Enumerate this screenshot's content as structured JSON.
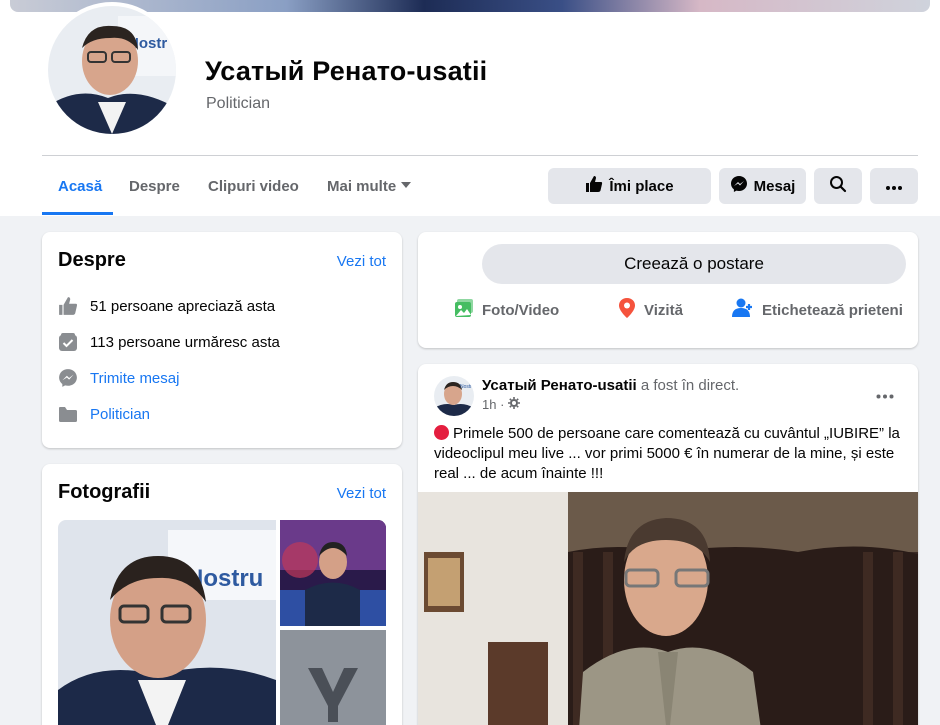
{
  "profile": {
    "name": "Усатый Ренато-usatii",
    "category": "Politician"
  },
  "tabs": [
    {
      "label": "Acasă"
    },
    {
      "label": "Despre"
    },
    {
      "label": "Clipuri video"
    },
    {
      "label": "Mai multe"
    }
  ],
  "actions": {
    "like": "Îmi place",
    "message": "Mesaj"
  },
  "about": {
    "title": "Despre",
    "see_all": "Vezi tot",
    "likes": "51 persoane apreciază asta",
    "followers": "113 persoane urmăresc asta",
    "send_message": "Trimite mesaj",
    "category": "Politician"
  },
  "photos": {
    "title": "Fotografii",
    "see_all": "Vezi tot"
  },
  "composer": {
    "create": "Creează o postare",
    "photo": "Foto/Video",
    "checkin": "Vizită",
    "tag": "Etichetează prieteni"
  },
  "post": {
    "author": "Усатый Ренато-usatii",
    "status": "a fost în direct.",
    "time": "1h ·",
    "text": "Primele 500 de persoane care comentează cu cuvântul „IUBIRE” la videoclipul meu live ... vor primi 5000 € în numerar de la mine, și este real ... de acum înainte !!!"
  },
  "colors": {
    "accent": "#1877f2",
    "background": "#f0f2f5",
    "button": "#e4e6eb",
    "live_dot": "#e41e3f"
  }
}
